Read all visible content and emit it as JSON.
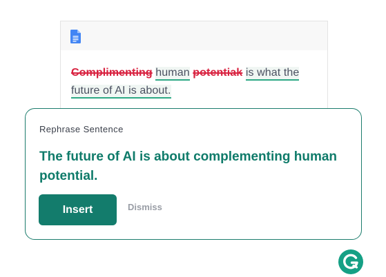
{
  "document": {
    "icon": "google-docs-icon",
    "deleted_word_1": "Complimenting",
    "kept_word": "human",
    "deleted_word_2": "potentiak",
    "inserted_phrase_1": "is what the",
    "inserted_phrase_2": "future of AI is about."
  },
  "suggestion": {
    "label": "Rephrase Sentence",
    "sentence": "The future of AI is about complementing human potential.",
    "insert_label": "Insert",
    "dismiss_label": "Dismiss"
  },
  "brand": {
    "logo_icon": "grammarly-logo-icon",
    "accent_color": "#137c6c",
    "delete_color": "#d8213f",
    "underline_color": "#2ca884"
  }
}
